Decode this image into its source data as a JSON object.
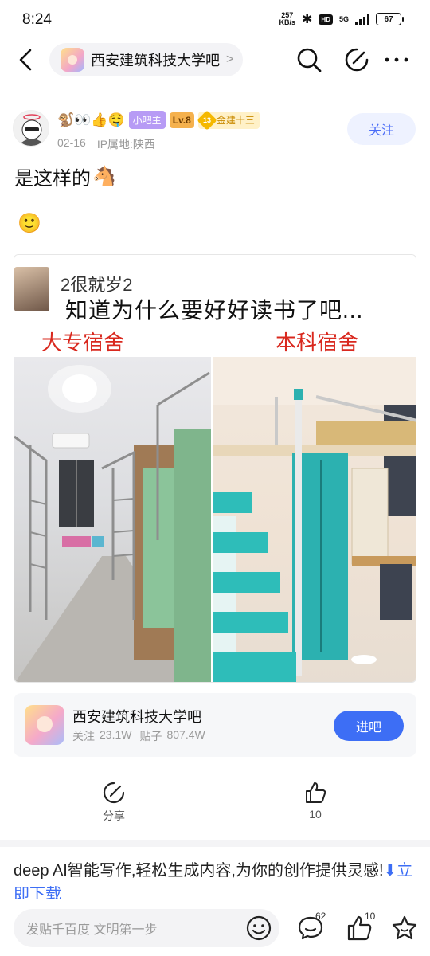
{
  "status": {
    "time": "8:24",
    "net_speed_value": "257",
    "net_speed_unit": "KB/s",
    "hd": "HD",
    "network": "5G",
    "battery": "67"
  },
  "nav": {
    "forum_name": "西安建筑科技大学吧",
    "chevron": ">"
  },
  "post": {
    "author_emoji": "🐒👀👍🤤",
    "owner_tag": "小吧主",
    "level_tag": "Lv.8",
    "rank_number": "13",
    "rank_title": "金建十三",
    "date": "02-16",
    "ip_location": "IP属地:陕西",
    "follow_label": "关注",
    "title": "是这样的",
    "title_emoji": "🐴",
    "body_emoji": "🙂"
  },
  "image": {
    "username": "2很就岁2",
    "caption": "知道为什么要好好读书了吧...",
    "label_left": "大专宿舍",
    "label_right": "本科宿舍"
  },
  "forum_card": {
    "name": "西安建筑科技大学吧",
    "follow_label": "关注",
    "follow_count": "23.1W",
    "posts_label": "贴子",
    "posts_count": "807.4W",
    "join_label": "进吧"
  },
  "actions": {
    "share_label": "分享",
    "like_count": "10"
  },
  "ad": {
    "text": "deep AI智能写作,轻松生成内容,为你的创作提供灵感!",
    "link": "⬇立即下载"
  },
  "bottom": {
    "placeholder": "发贴千百度 文明第一步",
    "comment_count": "62",
    "like_count": "10"
  },
  "colors": {
    "accent": "#3d6ef5",
    "follow_bg": "#eef2ff",
    "owner_tag": "#b79bf5",
    "level_tag": "#f5b14d",
    "red_label": "#d9281e"
  }
}
